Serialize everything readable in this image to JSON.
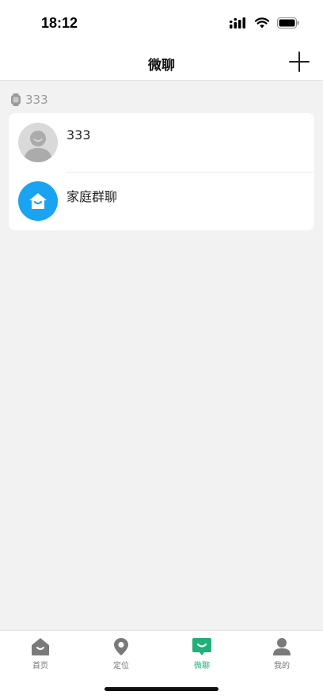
{
  "status_bar": {
    "time": "18:12"
  },
  "nav": {
    "title": "微聊",
    "add_icon": "plus-icon"
  },
  "device": {
    "name": "333",
    "icon": "watch-icon"
  },
  "chats": [
    {
      "name": "333",
      "avatar": "user-avatar"
    },
    {
      "name": "家庭群聊",
      "avatar": "family-home-icon"
    }
  ],
  "tabs": [
    {
      "label": "首页",
      "icon": "home-icon",
      "active": false
    },
    {
      "label": "定位",
      "icon": "location-pin-icon",
      "active": false
    },
    {
      "label": "微聊",
      "icon": "chat-icon",
      "active": true
    },
    {
      "label": "我的",
      "icon": "person-icon",
      "active": false
    }
  ],
  "colors": {
    "accent": "#22b07a",
    "family_avatar": "#1aa3f0",
    "background": "#f2f2f2",
    "inactive_icon": "#7a7a7a"
  }
}
